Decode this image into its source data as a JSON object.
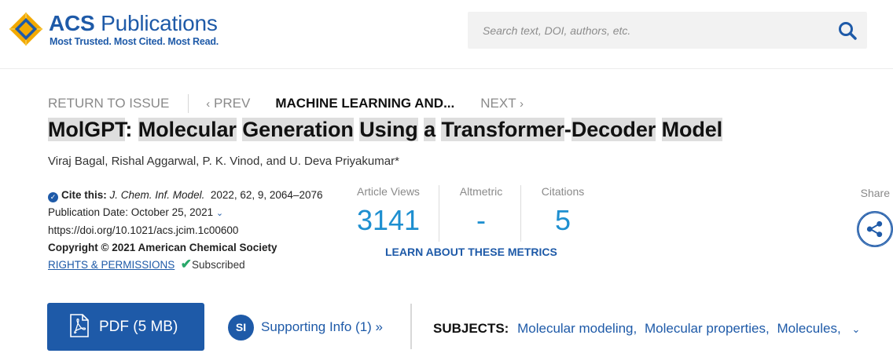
{
  "header": {
    "brand_acs": "ACS",
    "brand_publications": "Publications",
    "tagline": "Most Trusted. Most Cited. Most Read.",
    "search_placeholder": "Search text, DOI, authors, etc.",
    "brand_color": "#1e5aa8"
  },
  "nav": {
    "return": "RETURN TO ISSUE",
    "prev": "PREV",
    "current": "MACHINE LEARNING AND...",
    "next": "NEXT"
  },
  "article": {
    "title_parts": [
      "MolGPT",
      ": ",
      "Molecular",
      " ",
      "Generation",
      " ",
      "Using",
      " ",
      "a",
      " ",
      "Transformer",
      "-",
      "Decoder",
      " ",
      "Model"
    ],
    "authors": "Viraj Bagal, Rishal Aggarwal, P. K. Vinod, and U. Deva Priyakumar*"
  },
  "citation": {
    "cite_label": "Cite this:",
    "journal": "J. Chem. Inf. Model.",
    "details": "2022, 62, 9, 2064–2076",
    "pub_date": "Publication Date: October 25, 2021",
    "doi": "https://doi.org/10.1021/acs.jcim.1c00600",
    "copyright": "Copyright © 2021 American Chemical Society",
    "rights": "RIGHTS & PERMISSIONS",
    "subscribed": "Subscribed"
  },
  "metrics": {
    "views_label": "Article Views",
    "views_value": "3141",
    "altmetric_label": "Altmetric",
    "altmetric_value": "-",
    "citations_label": "Citations",
    "citations_value": "5",
    "learn_more": "LEARN ABOUT THESE METRICS",
    "value_color": "#1e8fd0"
  },
  "share": {
    "label": "Share"
  },
  "actions": {
    "pdf_label": "PDF (5 MB)",
    "si_badge": "SI",
    "si_label": "Supporting Info (1) »",
    "subjects_label": "SUBJECTS:",
    "subjects": [
      "Molecular modeling",
      "Molecular properties",
      "Molecules"
    ]
  },
  "icons": [
    "acs-logo-icon",
    "search-icon",
    "chevron-left-icon",
    "chevron-right-icon",
    "check-badge-icon",
    "chevron-down-icon",
    "checkmark-icon",
    "share-icon",
    "pdf-file-icon"
  ]
}
